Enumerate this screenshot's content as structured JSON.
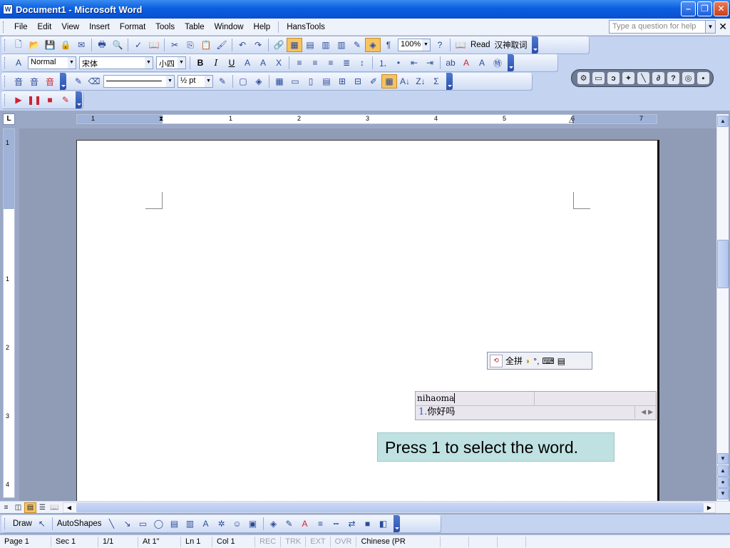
{
  "window": {
    "title": "Document1 - Microsoft Word",
    "app_icon": "W",
    "minimize_glyph": "–",
    "maximize_glyph": "❐",
    "close_glyph": "✕"
  },
  "menubar": {
    "items": [
      "File",
      "Edit",
      "View",
      "Insert",
      "Format",
      "Tools",
      "Table",
      "Window",
      "Help",
      "HansTools"
    ],
    "help_placeholder": "Type a question for help",
    "close_glyph": "✕"
  },
  "toolbar_standard": {
    "zoom": "100%",
    "read_label": "Read",
    "translate_label": "汉神取词"
  },
  "toolbar_formatting": {
    "style": "Normal",
    "font": "宋体",
    "font_size": "小四",
    "bold": "B",
    "italic": "I",
    "underline": "U"
  },
  "toolbar_tables": {
    "line_weight": "½ pt",
    "sum": "Σ"
  },
  "ime_panel": {
    "mode": "全拼"
  },
  "ime_composition": {
    "input": "nihaoma",
    "candidate_index": "1.",
    "candidate": "你好吗"
  },
  "callout": {
    "text": "Press 1 to select the word."
  },
  "ruler": {
    "h_numbers": [
      "1",
      "1",
      "2",
      "3",
      "4",
      "5",
      "6",
      "7"
    ],
    "v_numbers": [
      "1",
      "1",
      "2",
      "3",
      "4"
    ],
    "corner_label": "L"
  },
  "draw_toolbar": {
    "draw_label": "Draw",
    "autoshapes_label": "AutoShapes"
  },
  "statusbar": {
    "page": "Page 1",
    "section": "Sec 1",
    "page_count": "1/1",
    "at": "At 1\"",
    "line": "Ln 1",
    "col": "Col 1",
    "rec": "REC",
    "trk": "TRK",
    "ext": "EXT",
    "ovr": "OVR",
    "language": "Chinese (PR"
  }
}
